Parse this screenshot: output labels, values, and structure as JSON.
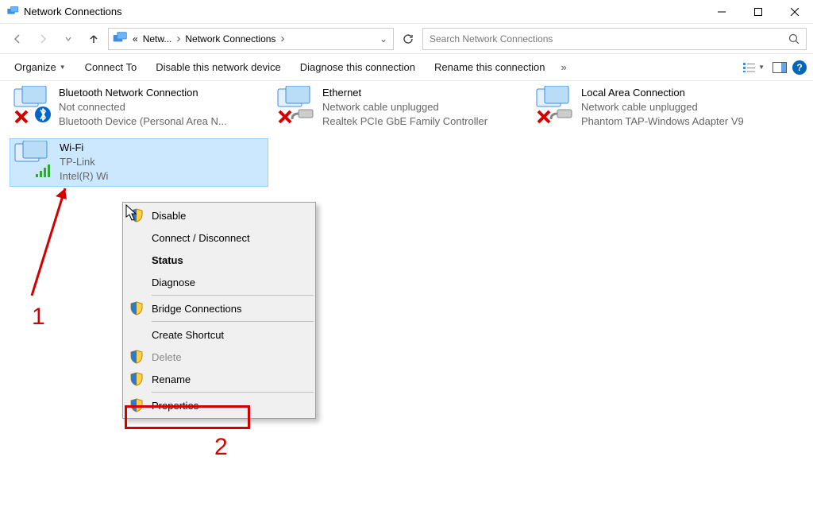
{
  "window": {
    "title": "Network Connections"
  },
  "breadcrumb": {
    "sep1": "«",
    "seg1": "Netw...",
    "arrow": "›",
    "seg2": "Network Connections",
    "arrow2": "›"
  },
  "search": {
    "placeholder": "Search Network Connections"
  },
  "toolbar": {
    "organize": "Organize",
    "connect_to": "Connect To",
    "disable": "Disable this network device",
    "diagnose": "Diagnose this connection",
    "rename": "Rename this connection",
    "overflow": "»"
  },
  "adapters": {
    "bt": {
      "name": "Bluetooth Network Connection",
      "status": "Not connected",
      "device": "Bluetooth Device (Personal Area N..."
    },
    "eth": {
      "name": "Ethernet",
      "status": "Network cable unplugged",
      "device": "Realtek PCIe GbE Family Controller"
    },
    "lan": {
      "name": "Local Area Connection",
      "status": "Network cable unplugged",
      "device": "Phantom TAP-Windows Adapter V9"
    },
    "wifi": {
      "name": "Wi-Fi",
      "status": "TP-Link",
      "device": "Intel(R) Wi"
    }
  },
  "context_menu": {
    "disable": "Disable",
    "connect": "Connect / Disconnect",
    "status": "Status",
    "diagnose": "Diagnose",
    "bridge": "Bridge Connections",
    "shortcut": "Create Shortcut",
    "delete": "Delete",
    "rename": "Rename",
    "properties": "Properties"
  },
  "annotations": {
    "one": "1",
    "two": "2"
  }
}
